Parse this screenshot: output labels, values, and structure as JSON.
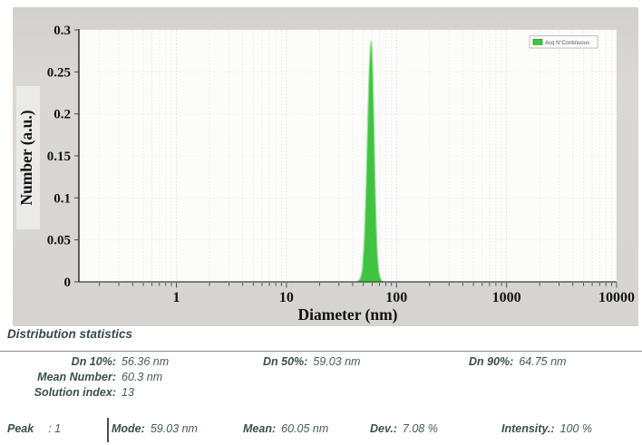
{
  "chart_data": {
    "type": "area",
    "title": "",
    "xlabel": "Diameter (nm)",
    "ylabel": "Number (a.u.)",
    "x_scale": "log",
    "x_range": [
      0.13,
      10000
    ],
    "y_range": [
      0,
      0.3
    ],
    "x_ticks": [
      1,
      10,
      100,
      1000,
      10000
    ],
    "x_tick_labels": [
      "1",
      "10",
      "100",
      "1000",
      "10000"
    ],
    "y_ticks": [
      0,
      0.05,
      0.1,
      0.15,
      0.2,
      0.25,
      0.3
    ],
    "y_tick_labels": [
      "0",
      "0.05",
      "0.1",
      "0.15",
      "0.2",
      "0.25",
      "0.3"
    ],
    "grid": "dotted vertical log-minor lines, faint dotted horizontal lines",
    "legend_position": "top-right",
    "legend": [
      {
        "label": "Acq N°Continuous",
        "swatch_color": "#40c340"
      }
    ],
    "series": [
      {
        "name": "Acq N°Continuous",
        "type": "area",
        "fill_color": "#40c340",
        "edge_color": "#90e090",
        "peak_mode_nm": 59.03,
        "peak_max_value": 0.2865,
        "points": [
          [
            44,
            0
          ],
          [
            47,
            0.004
          ],
          [
            49,
            0.015
          ],
          [
            51,
            0.05
          ],
          [
            53,
            0.115
          ],
          [
            55,
            0.2
          ],
          [
            56.5,
            0.253
          ],
          [
            57.8,
            0.279
          ],
          [
            58.8,
            0.2865
          ],
          [
            59.5,
            0.283
          ],
          [
            60.5,
            0.262
          ],
          [
            61.5,
            0.225
          ],
          [
            62.5,
            0.185
          ],
          [
            64,
            0.115
          ],
          [
            65.5,
            0.065
          ],
          [
            67,
            0.033
          ],
          [
            69,
            0.013
          ],
          [
            71,
            0.005
          ],
          [
            73.5,
            0.001
          ],
          [
            76,
            0
          ]
        ]
      }
    ]
  },
  "colors": {
    "accent_green": "#40c340",
    "stats_text": "#3c4e50",
    "widget_bg": "#d6d4d0",
    "plot_bg": "#fcfcfb"
  },
  "stats": {
    "title": "Distribution statistics",
    "columns": [
      {
        "rows": [
          {
            "label": "Dn 10%:",
            "value": "56.36 nm"
          },
          {
            "label": "Mean Number:",
            "value": "60.3 nm"
          },
          {
            "label": "Solution index:",
            "value": "13"
          }
        ]
      },
      {
        "rows": [
          {
            "label": "Dn 50%:",
            "value": "59.03 nm"
          }
        ]
      },
      {
        "rows": [
          {
            "label": "Dn 90%:",
            "value": "64.75 nm"
          }
        ]
      }
    ]
  },
  "peak_row": {
    "peak_label": "Peak",
    "peak_value": ": 1",
    "items": [
      {
        "label": "Mode:",
        "value": "59.03 nm"
      },
      {
        "label": "Mean:",
        "value": "60.05 nm"
      },
      {
        "label": "Dev.:",
        "value": "7.08 %"
      },
      {
        "label": "Intensity.:",
        "value": "100 %"
      }
    ]
  }
}
